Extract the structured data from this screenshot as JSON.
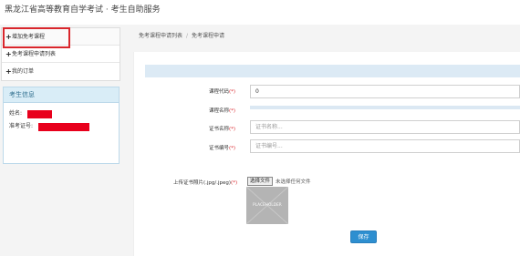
{
  "header": {
    "title": "黑龙江省高等教育自学考试 · 考生自助服务"
  },
  "sidebar": {
    "items": [
      {
        "label": "增加免考课程",
        "icon": "plus-icon"
      },
      {
        "label": "免考课程申请列表",
        "icon": "plus-icon"
      },
      {
        "label": "我的订单",
        "icon": "plus-icon"
      }
    ],
    "info": {
      "title": "考生信息",
      "name_label": "姓名:",
      "id_label": "准考证号:"
    }
  },
  "breadcrumb": {
    "items": [
      "免考课程申请列表",
      "免考课程申请"
    ],
    "separator": "/"
  },
  "form": {
    "required_mark": "(*)",
    "course_code": {
      "label": "课程代码",
      "value": "0"
    },
    "course_name": {
      "label": "课程名称"
    },
    "cert_name": {
      "label": "证书名称",
      "placeholder": "证书名称..."
    },
    "cert_no": {
      "label": "证书编号",
      "placeholder": "证书编号..."
    },
    "upload": {
      "label": "上传证书照片(.jpg/.jpeg)",
      "button": "选择文件",
      "status": "未选择任何文件",
      "image_text": "PLACEHOLDER"
    },
    "save_label": "保存"
  },
  "colors": {
    "accent": "#2e8fd0",
    "highlight": "#d9262c",
    "redaction": "#e8001c",
    "panel_header": "#d9edf7"
  }
}
